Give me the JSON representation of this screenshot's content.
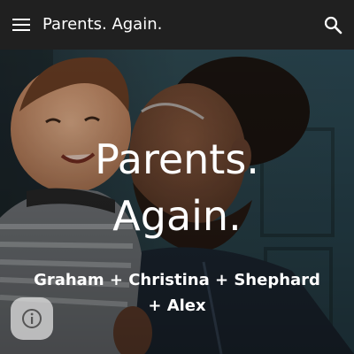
{
  "header": {
    "title": "Parents. Again.",
    "menu_icon": "hamburger-menu-icon",
    "search_icon": "search-icon",
    "background_color": "#202020"
  },
  "hero": {
    "title": "Parents. Again.",
    "subtitle": "Graham + Christina + Shephard + Alex",
    "photo": "father-kissing-toddler-photo",
    "text_color": "#ffffff"
  },
  "floating": {
    "info_icon": "info-icon"
  }
}
